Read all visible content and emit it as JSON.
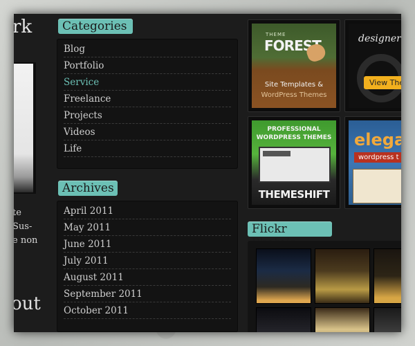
{
  "left": {
    "heading": "rk",
    "text_lines": [
      "te",
      "Sus-",
      "e non"
    ],
    "about": "out"
  },
  "categories": {
    "title": "Categories",
    "items": [
      {
        "label": "Blog"
      },
      {
        "label": "Portfolio"
      },
      {
        "label": "Service"
      },
      {
        "label": "Freelance"
      },
      {
        "label": "Projects"
      },
      {
        "label": "Videos"
      },
      {
        "label": "Life"
      }
    ],
    "active_index": 2
  },
  "archives": {
    "title": "Archives",
    "items": [
      {
        "label": "April 2011"
      },
      {
        "label": "May 2011"
      },
      {
        "label": "June 2011"
      },
      {
        "label": "July 2011"
      },
      {
        "label": "August 2011"
      },
      {
        "label": "September 2011"
      },
      {
        "label": "October 2011"
      }
    ]
  },
  "ads": {
    "themeforest": {
      "small": "THEME",
      "logo": "FOREST",
      "line1": "Site Templates &",
      "line2": "WordPress Themes"
    },
    "designer": {
      "title": "designer th",
      "button": "View The"
    },
    "themeshift": {
      "line1": "PROFESSIONAL",
      "line2": "WORDPRESS THEMES",
      "logo": "THEMESHIFT"
    },
    "elegant": {
      "logo": "elega",
      "tag": "wordpress t"
    }
  },
  "flickr": {
    "title": "Flickr Photo’s"
  },
  "colors": {
    "accent": "#6cc0b5",
    "panel": "#131313",
    "frame": "#1c1c1c"
  }
}
